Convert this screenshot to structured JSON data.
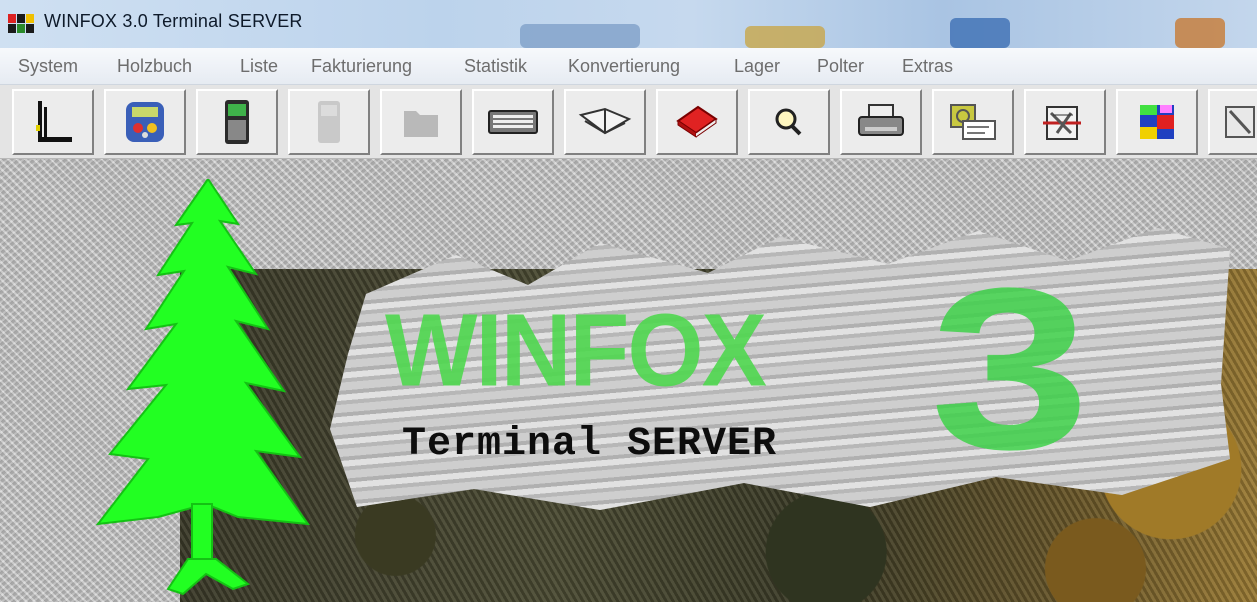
{
  "window": {
    "title": "WINFOX 3.0 Terminal SERVER"
  },
  "menu": {
    "items": [
      "System",
      "Holzbuch",
      "Liste",
      "Fakturierung",
      "Statistik",
      "Konvertierung",
      "Lager",
      "Polter",
      "Extras"
    ]
  },
  "toolbar": {
    "buttons": [
      {
        "icon": "antenna-icon",
        "enabled": true
      },
      {
        "icon": "handheld-device-icon",
        "enabled": true
      },
      {
        "icon": "terminal-device-icon",
        "enabled": true
      },
      {
        "icon": "terminal-device-disabled-icon",
        "enabled": false
      },
      {
        "icon": "folder-disabled-icon",
        "enabled": false
      },
      {
        "icon": "keyboard-icon",
        "enabled": true
      },
      {
        "icon": "open-book-icon",
        "enabled": true
      },
      {
        "icon": "red-book-icon",
        "enabled": true
      },
      {
        "icon": "search-icon",
        "enabled": true
      },
      {
        "icon": "printer-icon",
        "enabled": true
      },
      {
        "icon": "address-card-icon",
        "enabled": true
      },
      {
        "icon": "tools-icon",
        "enabled": true
      },
      {
        "icon": "colorful-app-icon",
        "enabled": true
      },
      {
        "icon": "close-icon",
        "enabled": true
      }
    ]
  },
  "splash": {
    "logo_text": "WINFOX",
    "logo_number": "3",
    "subtitle": "Terminal SERVER"
  },
  "colors": {
    "logo_green": "#3fd24a",
    "tree_green": "#22ff22",
    "menu_text": "#6d6d6d"
  }
}
